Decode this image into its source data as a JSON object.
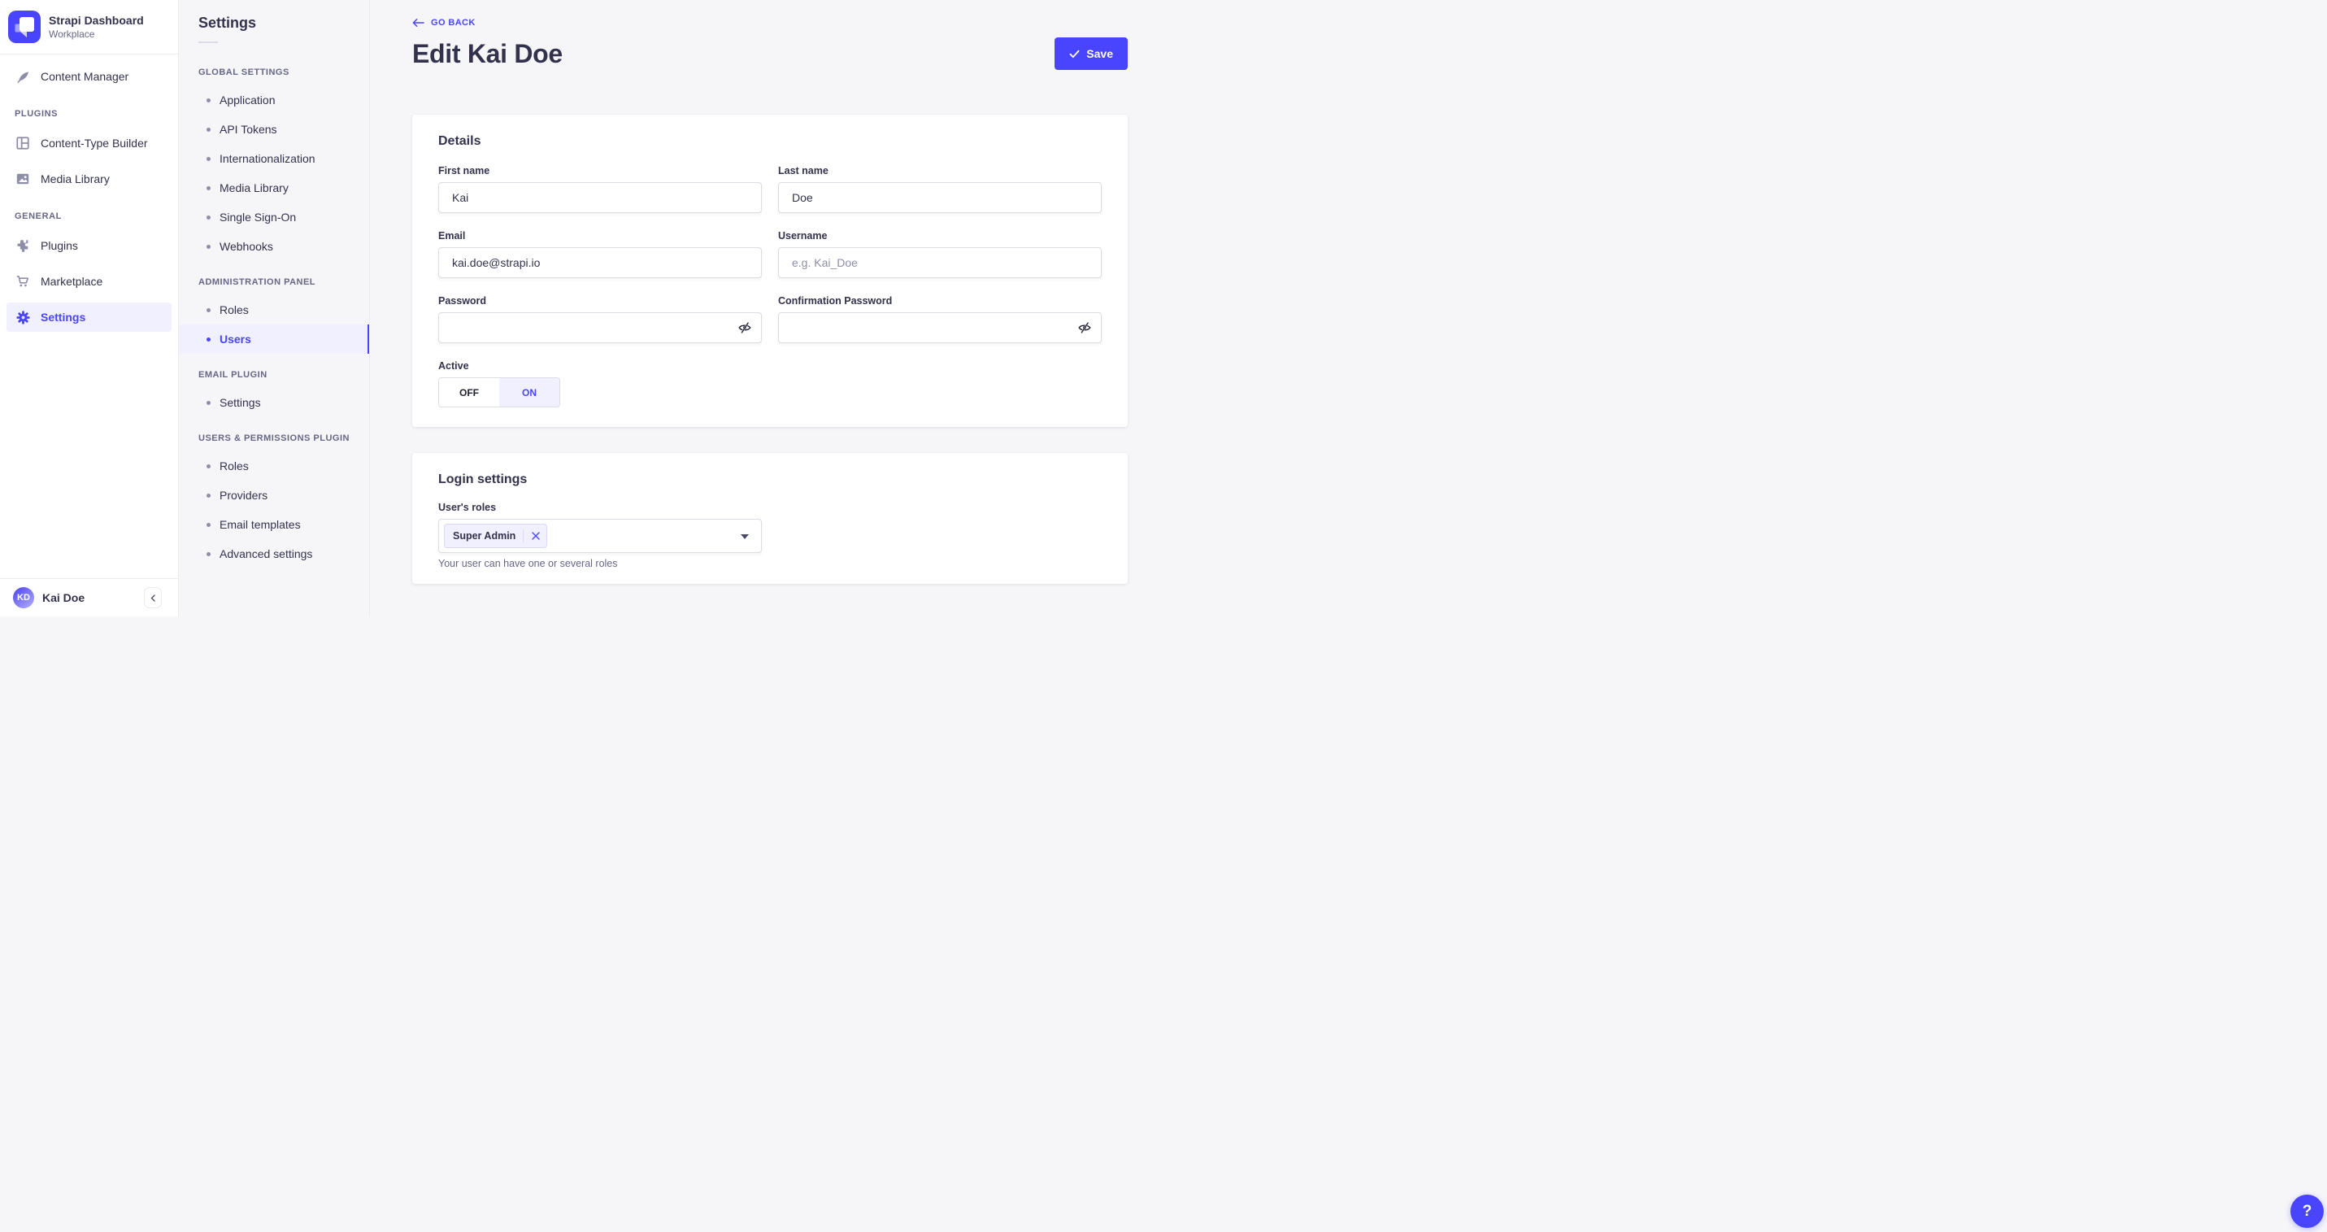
{
  "brand": {
    "title": "Strapi Dashboard",
    "subtitle": "Workplace"
  },
  "sidebar": {
    "content_manager": "Content Manager",
    "sections": [
      {
        "header": "PLUGINS",
        "items": [
          "Content-Type Builder",
          "Media Library"
        ]
      },
      {
        "header": "GENERAL",
        "items": [
          "Plugins",
          "Marketplace",
          "Settings"
        ]
      }
    ],
    "active_item": "Settings",
    "user": {
      "initials": "KD",
      "name": "Kai Doe"
    }
  },
  "subnav": {
    "title": "Settings",
    "groups": [
      {
        "header": "GLOBAL SETTINGS",
        "items": [
          "Application",
          "API Tokens",
          "Internationalization",
          "Media Library",
          "Single Sign-On",
          "Webhooks"
        ]
      },
      {
        "header": "ADMINISTRATION PANEL",
        "items": [
          "Roles",
          "Users"
        ]
      },
      {
        "header": "EMAIL PLUGIN",
        "items": [
          "Settings"
        ]
      },
      {
        "header": "USERS & PERMISSIONS PLUGIN",
        "items": [
          "Roles",
          "Providers",
          "Email templates",
          "Advanced settings"
        ]
      }
    ],
    "active_item": "Users"
  },
  "header": {
    "back_label": "GO BACK",
    "title": "Edit Kai Doe",
    "save_label": "Save"
  },
  "details": {
    "heading": "Details",
    "first_name": {
      "label": "First name",
      "value": "Kai"
    },
    "last_name": {
      "label": "Last name",
      "value": "Doe"
    },
    "email": {
      "label": "Email",
      "value": "kai.doe@strapi.io"
    },
    "username": {
      "label": "Username",
      "placeholder": "e.g. Kai_Doe"
    },
    "password": {
      "label": "Password"
    },
    "confirmation_password": {
      "label": "Confirmation Password"
    },
    "active": {
      "label": "Active",
      "off": "OFF",
      "on": "ON",
      "selected": "ON"
    }
  },
  "login": {
    "heading": "Login settings",
    "roles_label": "User's roles",
    "selected_role": "Super Admin",
    "hint": "Your user can have one or several roles"
  },
  "help_glyph": "?",
  "colors": {
    "primary": "#4945ff",
    "primary_bg": "#f0f0ff",
    "text": "#32324d",
    "muted": "#666687",
    "icon": "#8e8ea9",
    "border": "#dcdce4",
    "divider": "#eaeaef",
    "bg": "#f6f6f9"
  }
}
